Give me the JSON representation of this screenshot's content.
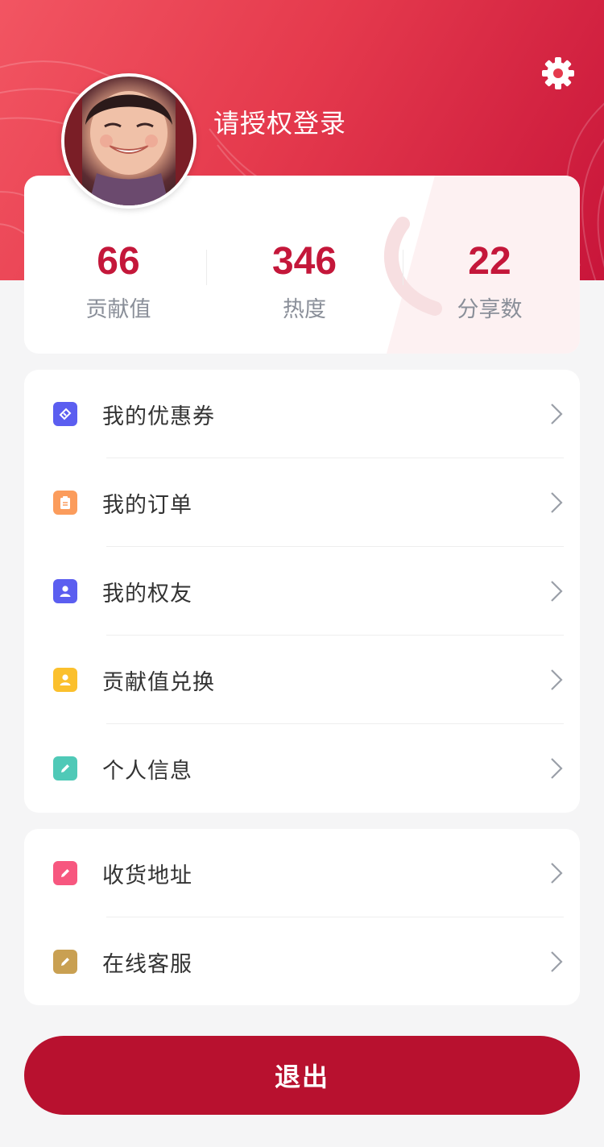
{
  "header": {
    "login_text": "请授权登录",
    "gradient_start": "#f25562",
    "gradient_end": "#c8153a"
  },
  "stats": [
    {
      "value": "66",
      "label": "贡献值"
    },
    {
      "value": "346",
      "label": "热度"
    },
    {
      "value": "22",
      "label": "分享数"
    }
  ],
  "menu_group_1": [
    {
      "label": "我的优惠券",
      "icon": "coupon-icon",
      "color": "#5b5ef0"
    },
    {
      "label": "我的订单",
      "icon": "clipboard-icon",
      "color": "#fb9c5c"
    },
    {
      "label": "我的权友",
      "icon": "user-icon",
      "color": "#5b5ef0"
    },
    {
      "label": "贡献值兑换",
      "icon": "user-icon",
      "color": "#fbc02d"
    },
    {
      "label": "个人信息",
      "icon": "pencil-icon",
      "color": "#4fc9b7"
    }
  ],
  "menu_group_2": [
    {
      "label": "收货地址",
      "icon": "pencil-icon",
      "color": "#f7577f"
    },
    {
      "label": "在线客服",
      "icon": "pencil-icon",
      "color": "#c9a052"
    }
  ],
  "logout_label": "退出",
  "accent_color": "#b8112f"
}
